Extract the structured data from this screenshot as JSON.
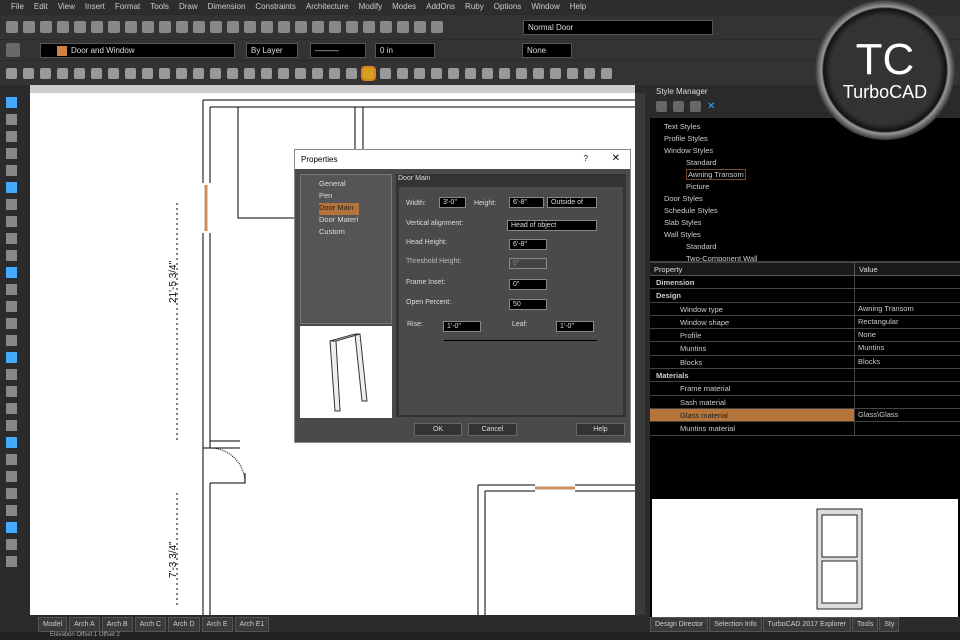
{
  "menu": [
    "File",
    "Edit",
    "View",
    "Insert",
    "Format",
    "Tools",
    "Draw",
    "Dimension",
    "Constraints",
    "Architecture",
    "Modify",
    "Modes",
    "AddOns",
    "Ruby",
    "Options",
    "Window",
    "Help"
  ],
  "toolbar": {
    "style_select": "Normal Door",
    "layer_select": "Door and Window",
    "pen_select": "By Layer",
    "width_field": "0 in",
    "none_select": "None"
  },
  "canvas": {
    "dim1": "21'-5 3/4\"",
    "dim2": "7'-3 3/4\""
  },
  "dialog": {
    "title": "Properties",
    "help_glyph": "?",
    "close_glyph": "✕",
    "tree": [
      "General",
      "Pen",
      "Door Main",
      "Door Materi",
      "Custom"
    ],
    "section": "Door Main",
    "width_label": "Width:",
    "width": "3'-0\"",
    "height_label": "Height:",
    "height": "6'-8\"",
    "outside": "Outside of",
    "valign_label": "Vertical alignment:",
    "valign": "Head of object",
    "head_label": "Head Height:",
    "head": "6'-8\"",
    "threshold_label": "Threshold Height:",
    "threshold": "0\"",
    "inset_label": "Frame Inset:",
    "inset": "0\"",
    "open_label": "Open Percent:",
    "open": "50",
    "rise_label": "Rise:",
    "rise": "1'-0\"",
    "leaf_label": "Leaf:",
    "leaf": "1'-0\"",
    "ok": "OK",
    "cancel": "Cancel",
    "help": "Help"
  },
  "style_manager": {
    "title": "Style Manager",
    "tree": [
      {
        "t": "Text Styles",
        "l": 0
      },
      {
        "t": "Profile Styles",
        "l": 0
      },
      {
        "t": "Window Styles",
        "l": 0
      },
      {
        "t": "Standard",
        "l": 1
      },
      {
        "t": "Awning Transom",
        "l": 1
      },
      {
        "t": "Picture",
        "l": 1
      },
      {
        "t": "Door Styles",
        "l": 0
      },
      {
        "t": "Schedule Styles",
        "l": 0
      },
      {
        "t": "Slab Styles",
        "l": 0
      },
      {
        "t": "Wall Styles",
        "l": 0
      },
      {
        "t": "Standard",
        "l": 1
      },
      {
        "t": "Two-Component Wall",
        "l": 1
      }
    ],
    "col_property": "Property",
    "col_value": "Value",
    "rows": [
      [
        "Dimension",
        ""
      ],
      [
        "Design",
        ""
      ],
      [
        "Window type",
        "Awning Transom"
      ],
      [
        "Window shape",
        "Rectangular"
      ],
      [
        "Profile",
        "None"
      ],
      [
        "Muntins",
        "Muntins"
      ],
      [
        "Blocks",
        "Blocks"
      ],
      [
        "Materials",
        ""
      ],
      [
        "Frame material",
        ""
      ],
      [
        "Sash material",
        ""
      ],
      [
        "Glass material",
        "Glass\\Glass"
      ],
      [
        "Muntins material",
        ""
      ]
    ]
  },
  "logo": {
    "mark": "TC",
    "name": "TurboCAD"
  },
  "tabs": [
    "Model",
    "Arch A",
    "Arch B",
    "Arch C",
    "Arch D",
    "Arch E",
    "Arch E1"
  ],
  "right_tabs": [
    "Design Director",
    "Selection Info",
    "TurboCAD 2017 Explorer",
    "Tools",
    "Sty"
  ],
  "status": "Elevation  Offset 1   Offset 2",
  "colors": {
    "accent": "#b5743a"
  }
}
